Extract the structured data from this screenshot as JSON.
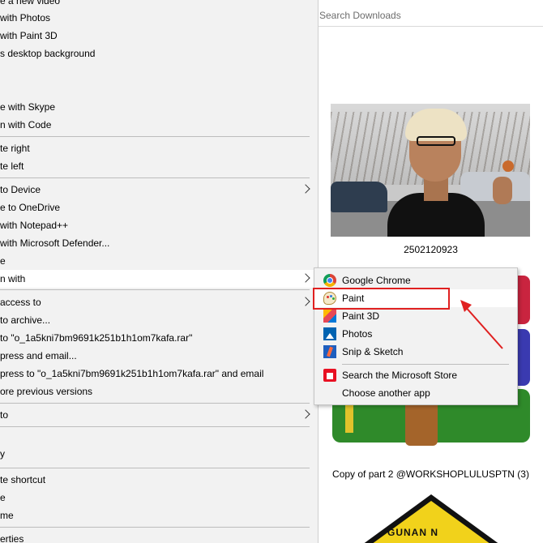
{
  "explorer": {
    "search_placeholder": "Search Downloads",
    "items": [
      {
        "caption": "2502120923"
      },
      {
        "caption": "Copy of part 2 @WORKSHOPLULUSPTN (3)"
      },
      {
        "badge_text": "GUNAN N"
      }
    ]
  },
  "context_menu": {
    "items": [
      {
        "label": "e a new video"
      },
      {
        "label": "with Photos"
      },
      {
        "label": "with Paint 3D"
      },
      {
        "label": "s desktop background"
      },
      {
        "label": "e with Skype"
      },
      {
        "label": "n with Code"
      },
      {
        "label": "te right"
      },
      {
        "label": "te left"
      },
      {
        "label": "to Device"
      },
      {
        "label": "e to OneDrive"
      },
      {
        "label": "with Notepad++"
      },
      {
        "label": " with Microsoft Defender..."
      },
      {
        "label": "e"
      },
      {
        "label": "n with"
      },
      {
        "label": " access to"
      },
      {
        "label": "to archive..."
      },
      {
        "label": "to \"o_1a5kni7bm9691k251b1h1om7kafa.rar\""
      },
      {
        "label": "press and email..."
      },
      {
        "label": "press to \"o_1a5kni7bm9691k251b1h1om7kafa.rar\" and email"
      },
      {
        "label": "ore previous versions"
      },
      {
        "label": " to"
      },
      {
        "label": "y"
      },
      {
        "label": "te shortcut"
      },
      {
        "label": "e"
      },
      {
        "label": "me"
      },
      {
        "label": "erties"
      }
    ]
  },
  "open_with_submenu": {
    "items": [
      {
        "label": "Google Chrome",
        "icon": "chrome-icon"
      },
      {
        "label": "Paint",
        "icon": "paint-icon"
      },
      {
        "label": "Paint 3D",
        "icon": "paint-3d-icon"
      },
      {
        "label": "Photos",
        "icon": "photos-icon"
      },
      {
        "label": "Snip & Sketch",
        "icon": "snip-sketch-icon"
      },
      {
        "label": "Search the Microsoft Store",
        "icon": "store-icon"
      },
      {
        "label": "Choose another app"
      }
    ],
    "highlighted": "Paint"
  },
  "annotation": {
    "color": "#e02020"
  }
}
